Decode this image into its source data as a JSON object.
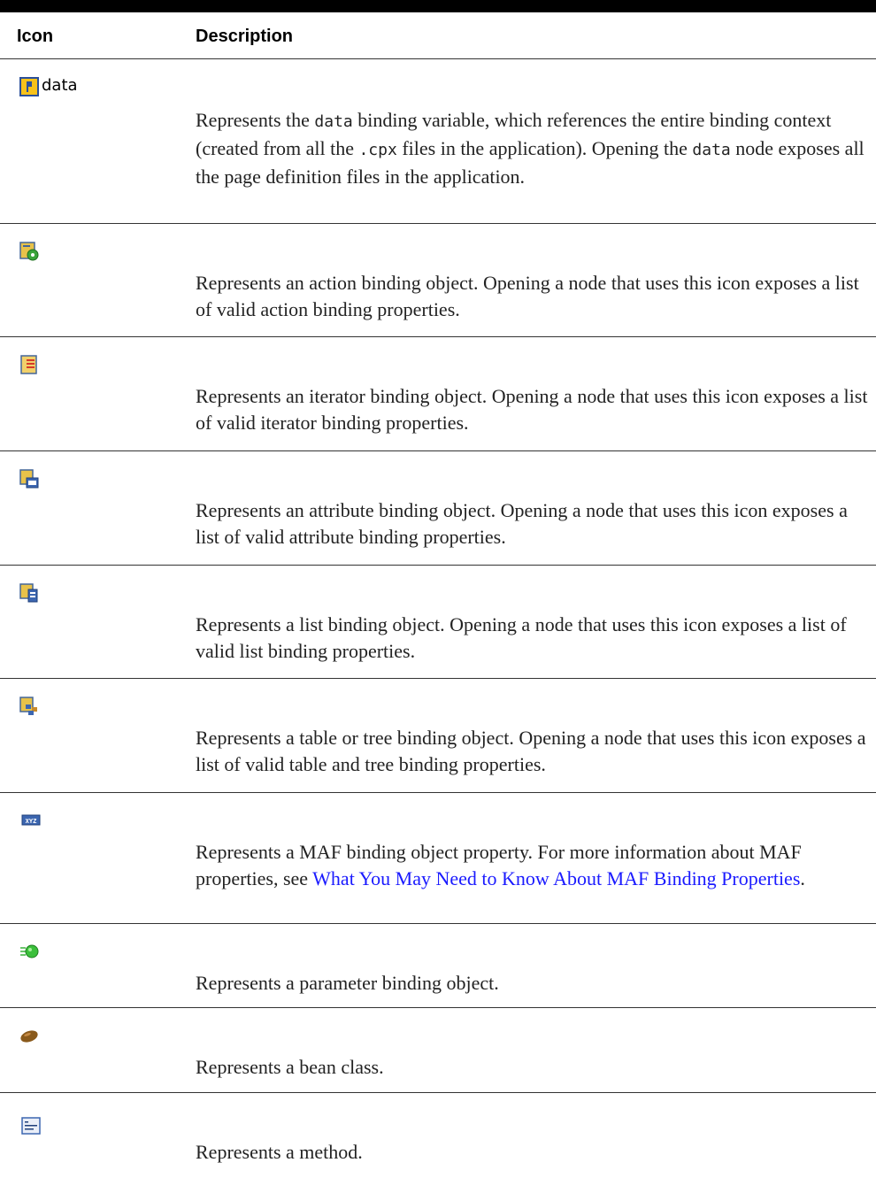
{
  "table": {
    "headers": {
      "icon": "Icon",
      "description": "Description"
    },
    "rows": [
      {
        "icon": "data-binding-variable-icon",
        "icon_label": "data",
        "desc": {
          "p1": "Represents the ",
          "c1": "data",
          "p2": " binding variable, which references the entire binding context (created from all the ",
          "c2": ".cpx",
          "p3": " files in the application). Opening the ",
          "c3": "data",
          "p4": " node exposes all the page definition files in the application."
        }
      },
      {
        "icon": "action-binding-icon",
        "text": "Represents an action binding object. Opening a node that uses this icon exposes a list of valid action binding properties."
      },
      {
        "icon": "iterator-binding-icon",
        "text": "Represents an iterator binding object. Opening a node that uses this icon exposes a list of valid iterator binding properties."
      },
      {
        "icon": "attribute-binding-icon",
        "text": "Represents an attribute binding object. Opening a node that uses this icon exposes a list of valid attribute binding properties."
      },
      {
        "icon": "list-binding-icon",
        "text": "Represents a list binding object. Opening a node that uses this icon exposes a list of valid list binding properties."
      },
      {
        "icon": "table-tree-binding-icon",
        "text": "Represents a table or tree binding object. Opening a node that uses this icon exposes a list of valid table and tree binding properties."
      },
      {
        "icon": "maf-property-icon",
        "desc": {
          "p1": "Represents a MAF binding object property. For more information about MAF properties, see ",
          "link": "What You May Need to Know About MAF Binding Properties",
          "p2": "."
        }
      },
      {
        "icon": "parameter-binding-icon",
        "text": "Represents a parameter binding object."
      },
      {
        "icon": "bean-class-icon",
        "text": "Represents a bean class."
      },
      {
        "icon": "method-icon",
        "text": "Represents a method."
      }
    ]
  },
  "colors": {
    "link": "#1a1aff",
    "rule": "#333333",
    "top_bar": "#000000"
  }
}
